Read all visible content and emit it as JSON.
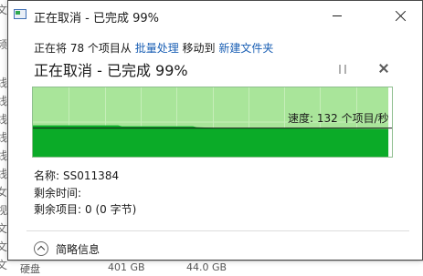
{
  "window": {
    "title": "正在取消 - 已完成 99%",
    "minimize_label": "",
    "close_label": ""
  },
  "operation": {
    "prefix": "正在将 78 个项目从 ",
    "source_link": "批量处理",
    "middle": " 移动到 ",
    "dest_link": "新建文件夹"
  },
  "status": {
    "heading": "正在取消 - 已完成 99%",
    "speed": "速度: 132 个项目/秒"
  },
  "chart_data": {
    "type": "area",
    "progress_percent": 99,
    "current_speed_fraction": 0.4
  },
  "details": {
    "name_label": "名称:",
    "name_value": "SS011384",
    "time_label": "剩余时间:",
    "time_value": "",
    "items_label": "剩余项目:",
    "items_value": "0 (0 字节)",
    "toggle_label": "简略信息"
  },
  "background": {
    "left_chars": [
      "文",
      "频",
      "线",
      "线",
      "线",
      "线",
      "线",
      "线",
      "女",
      "视",
      "文",
      "文",
      "文"
    ],
    "bottom_text_1": "硬盘",
    "bottom_text_2": "401 GB",
    "bottom_text_3": "44.0 GB"
  },
  "colors": {
    "progress_fill": "#a9e59a",
    "speed_fill": "#0bab28",
    "link": "#1a5fb4"
  }
}
